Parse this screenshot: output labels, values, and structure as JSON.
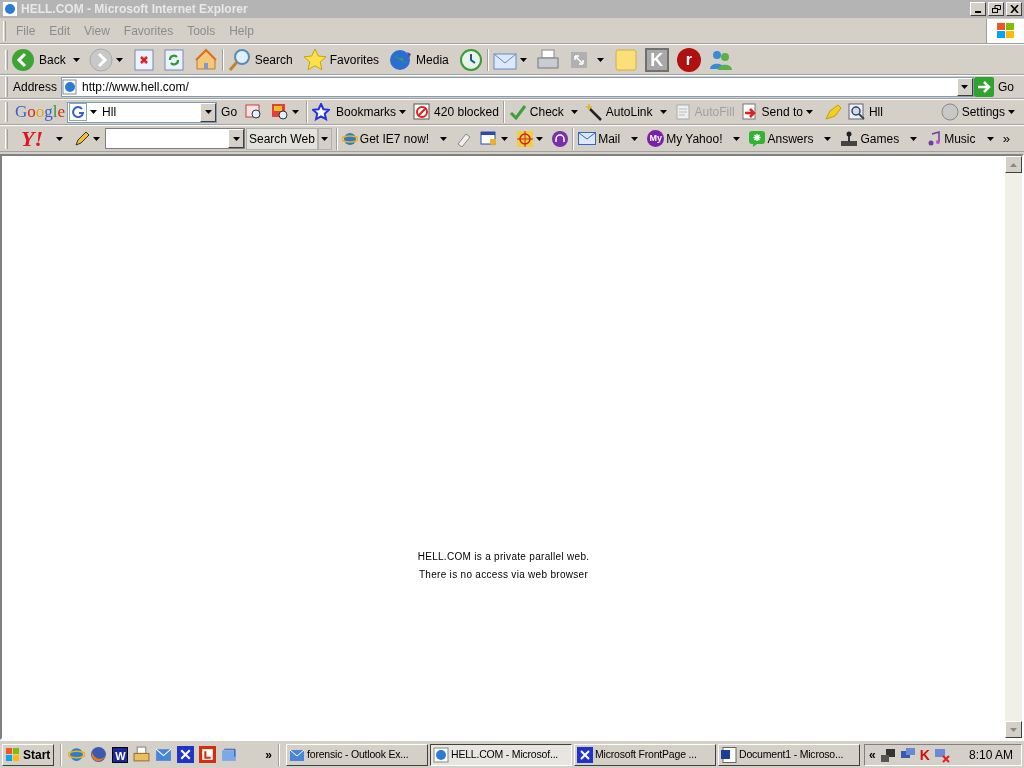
{
  "window": {
    "title": "HELL.COM - Microsoft Internet Explorer",
    "active": false
  },
  "menu": [
    "File",
    "Edit",
    "View",
    "Favorites",
    "Tools",
    "Help"
  ],
  "standard_toolbar": {
    "back": "Back",
    "search": "Search",
    "favorites": "Favorites",
    "media": "Media",
    "k_button": "K",
    "r_button": "r"
  },
  "address_bar": {
    "label": "Address",
    "value": "http://www.hell.com/",
    "go": "Go"
  },
  "google_toolbar": {
    "logo": "Google",
    "search_value": "Hll",
    "go": "Go",
    "bookmarks": "Bookmarks",
    "blocked": "420 blocked",
    "check": "Check",
    "autolink": "AutoLink",
    "autofill": {
      "label": "AutoFill",
      "disabled": true
    },
    "send_to": "Send to",
    "find": "Hll",
    "settings": "Settings"
  },
  "yahoo_toolbar": {
    "logo": "Y!",
    "search_button": "Search Web",
    "items": [
      {
        "label": "Get IE7 now!"
      },
      {
        "label": "Mail"
      },
      {
        "label": "My Yahoo!",
        "badge": "My"
      },
      {
        "label": "Answers"
      },
      {
        "label": "Games"
      },
      {
        "label": "Music"
      }
    ],
    "more": "»"
  },
  "page": {
    "lines": [
      "HELL.COM is a private parallel web.",
      "There is no access via web browser"
    ]
  },
  "taskbar": {
    "start": "Start",
    "quick_launch_letter": "W",
    "quick_launch_more": "»",
    "tasks": [
      {
        "label": "forensic - Outlook Ex...",
        "selected": false
      },
      {
        "label": "HELL.COM - Microsof...",
        "selected": true
      },
      {
        "label": "Microsoft FrontPage ...",
        "selected": false
      },
      {
        "label": "Document1 - Microso...",
        "selected": false
      }
    ],
    "tray_expand": "«",
    "tray_letter": "K",
    "clock": "8:10 AM"
  }
}
